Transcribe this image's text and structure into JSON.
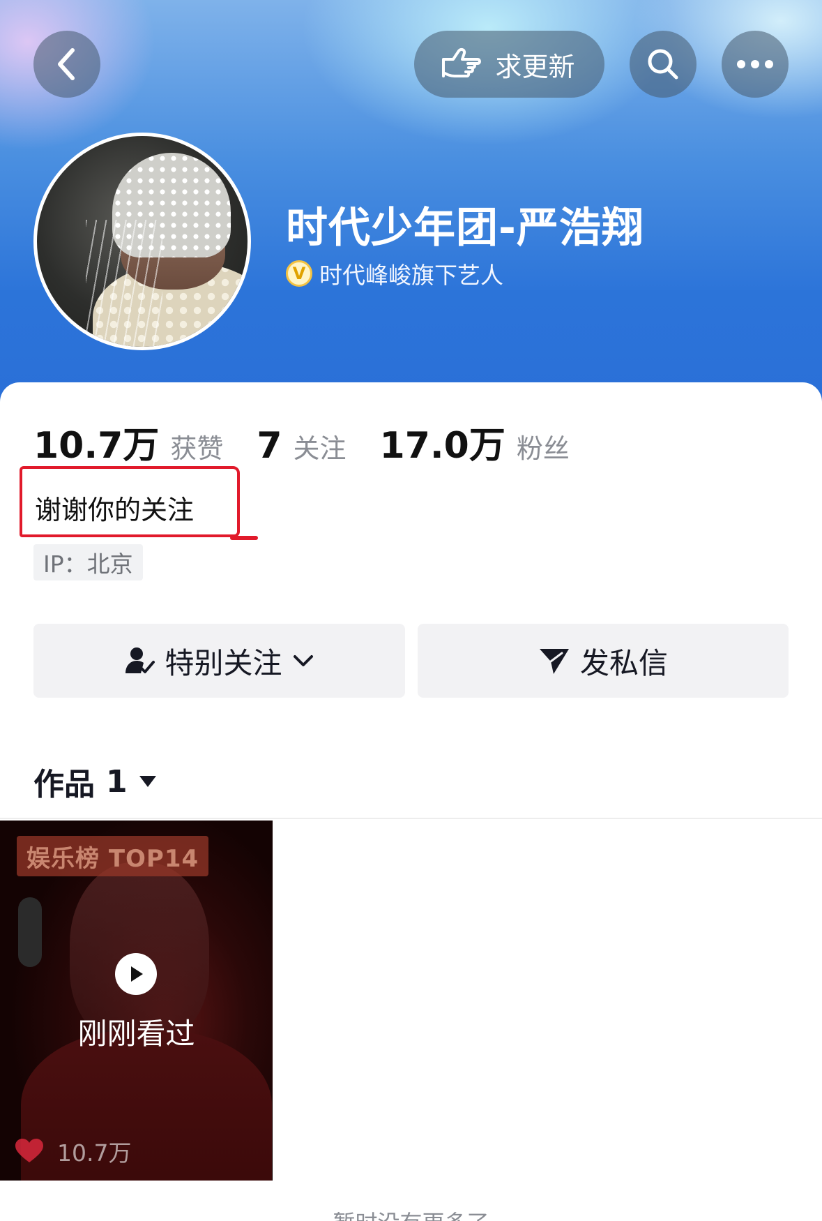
{
  "header": {
    "request_update_label": "求更新"
  },
  "profile": {
    "name": "时代少年团-严浩翔",
    "verify_badge": "V",
    "verified_text": "时代峰峻旗下艺人",
    "bio": "谢谢你的关注",
    "ip_location": "IP：北京"
  },
  "stats": [
    {
      "value": "10.7万",
      "label": "获赞"
    },
    {
      "value": "7",
      "label": "关注"
    },
    {
      "value": "17.0万",
      "label": "粉丝"
    }
  ],
  "actions": {
    "follow_label": "特别关注",
    "message_label": "发私信"
  },
  "works": {
    "label": "作品",
    "count": "1"
  },
  "videos": [
    {
      "badge": "娱乐榜 TOP14",
      "overlay": "刚刚看过",
      "likes": "10.7万"
    }
  ],
  "footer": {
    "note": "暂时没有更多了"
  },
  "colors": {
    "accent_red": "#e11a2b",
    "header_blue": "#2c74d9",
    "verify_gold": "#f5c342"
  }
}
